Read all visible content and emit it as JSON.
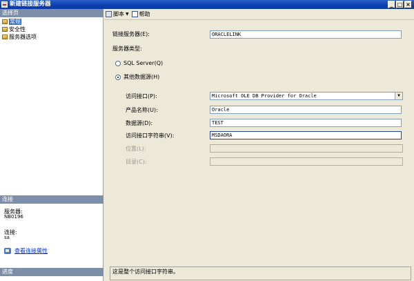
{
  "window": {
    "title": "新建链接服务器",
    "controls": [
      "_",
      "□",
      "×"
    ]
  },
  "left_panel": {
    "select_page_header": "选择页",
    "pages": [
      {
        "label": "常规",
        "selected": true
      },
      {
        "label": "安全性",
        "selected": false
      },
      {
        "label": "服务器选项",
        "selected": false
      }
    ],
    "connection": {
      "header": "连接",
      "server_label": "服务器:",
      "server_value": "NB0196",
      "connection_label": "连接:",
      "connection_value": "sa",
      "view_properties_link": "查看连接属性"
    },
    "progress_header": "进度"
  },
  "toolbar": {
    "script_label": "脚本",
    "script_arrow": "▼",
    "help_label": "帮助"
  },
  "form": {
    "linked_server_label": "链接服务器(E):",
    "linked_server_value": "ORACLELINK",
    "server_type_label": "服务器类型:",
    "radio_sql_server_label": "SQL Server(Q)",
    "radio_other_source_label": "其他数据源(H)",
    "provider_label": "访问接口(P):",
    "provider_value": "Microsoft OLE DB Provider for Oracle",
    "product_name_label": "产品名称(U):",
    "product_name_value": "Oracle",
    "data_source_label": "数据源(D):",
    "data_source_value": "TEST",
    "provider_string_label": "访问接口字符串(V):",
    "provider_string_value": "MSDAORA",
    "location_label": "位置(L):",
    "location_value": "",
    "catalog_label": "目录(C):",
    "catalog_value": ""
  },
  "description": "这是整个访问接口字符串。"
}
